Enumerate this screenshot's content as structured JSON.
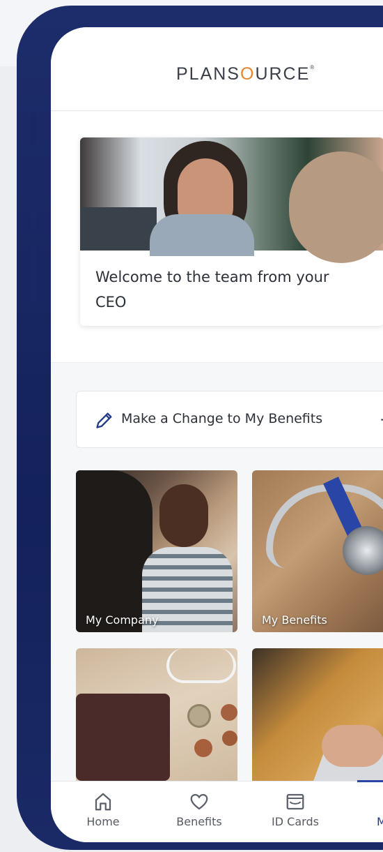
{
  "header": {
    "logo_pre": "PLANS",
    "logo_o": "O",
    "logo_post": "URCE",
    "logo_mark": "®"
  },
  "welcome_card": {
    "text": "Welcome to the team from your CEO"
  },
  "change_benefits": {
    "label": "Make a Change to My Benefits",
    "arrow": "→"
  },
  "tiles": [
    {
      "caption": "My Company"
    },
    {
      "caption": "My Benefits"
    },
    {
      "caption": ""
    },
    {
      "caption": ""
    }
  ],
  "tabbar": {
    "items": [
      {
        "label": "Home",
        "icon": "home-icon"
      },
      {
        "label": "Benefits",
        "icon": "heart-icon"
      },
      {
        "label": "ID Cards",
        "icon": "id-card-icon"
      },
      {
        "label": "More",
        "icon": "menu-icon",
        "active": true
      }
    ]
  },
  "colors": {
    "brand_blue": "#233a8a",
    "logo_accent": "#e7852a",
    "frame": "#1a2a66"
  }
}
